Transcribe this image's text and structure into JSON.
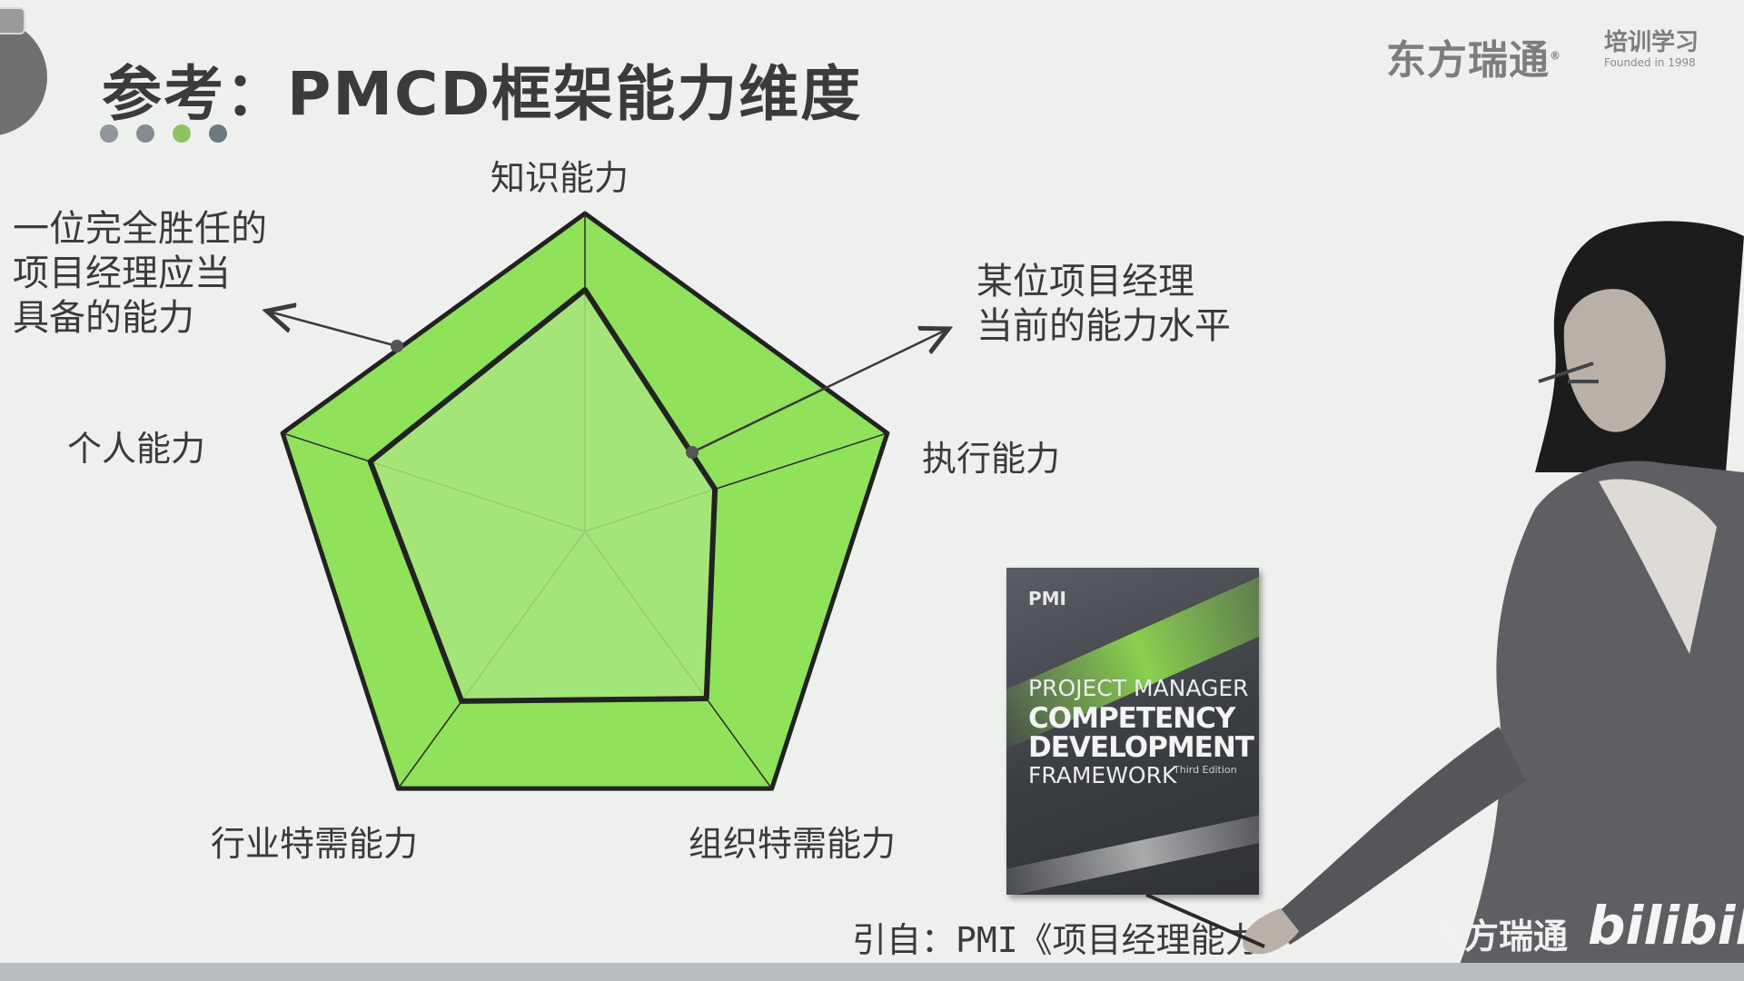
{
  "title": "参考：PMCD框架能力维度",
  "dots": [
    "#8f969c",
    "#848b92",
    "#8cc264",
    "#6b7a80"
  ],
  "brand": {
    "name": "东方瑞通",
    "mark": "®",
    "side_top": "培训学习",
    "side_sub": "Founded in 1998"
  },
  "radar": {
    "outer_fill": "#8fe25a",
    "inner_fill": "#a8e57f",
    "axes": [
      {
        "label": "知识能力",
        "full": 1.0,
        "current": 0.76
      },
      {
        "label": "执行能力",
        "full": 1.0,
        "current": 0.43
      },
      {
        "label": "组织特需能力",
        "full": 1.0,
        "current": 0.65
      },
      {
        "label": "行业特需能力",
        "full": 1.0,
        "current": 0.66
      },
      {
        "label": "个人能力",
        "full": 1.0,
        "current": 0.71
      }
    ]
  },
  "notes": {
    "full_lines": [
      "一位完全胜任的",
      "项目经理应当",
      "具备的能力"
    ],
    "current_lines": [
      "某位项目经理",
      "当前的能力水平"
    ]
  },
  "book": {
    "publisher": "PMI",
    "line1": "PROJECT MANAGER",
    "line2": "COMPETENCY",
    "line3": "DEVELOPMENT",
    "line4": "FRAMEWORK",
    "edition": "Third Edition"
  },
  "citation": "引自：PMI《项目经理能力",
  "watermark": {
    "brand": "东方瑞通",
    "site": "bilibili"
  }
}
